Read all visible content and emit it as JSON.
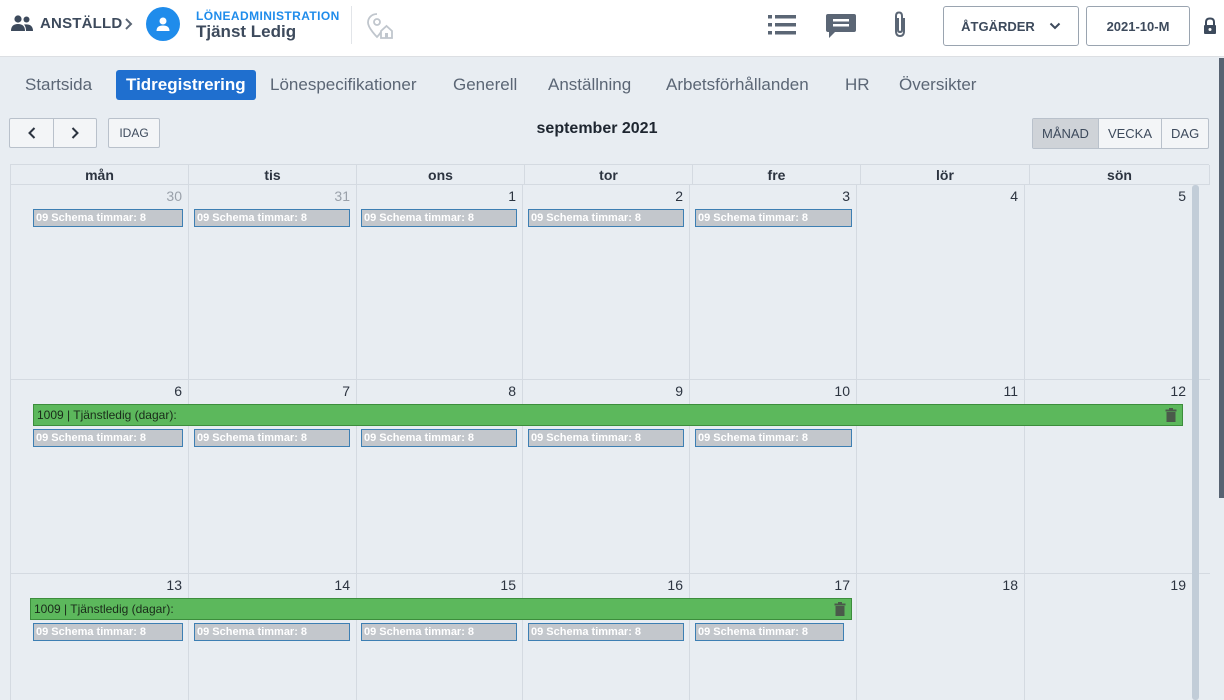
{
  "header": {
    "employee_label": "ANSTÄLLD",
    "module_label": "LÖNEADMINISTRATION",
    "person_name": "Tjänst Ledig",
    "actions_label": "ÅTGÄRDER",
    "period_label": "2021-10-M",
    "icons": [
      "people-icon",
      "chevron-right-icon",
      "person-icon",
      "location-home-icon",
      "list-icon",
      "chat-icon",
      "paperclip-icon",
      "chevron-down-icon",
      "lock-icon"
    ]
  },
  "tabs": [
    {
      "label": "Startsida",
      "active": false
    },
    {
      "label": "Tidregistrering",
      "active": true
    },
    {
      "label": "Lönespecifikationer",
      "active": false
    },
    {
      "label": "Generell",
      "active": false
    },
    {
      "label": "Anställning",
      "active": false
    },
    {
      "label": "Arbetsförhållanden",
      "active": false
    },
    {
      "label": "HR",
      "active": false
    },
    {
      "label": "Översikter",
      "active": false
    }
  ],
  "calendar": {
    "title": "september 2021",
    "today_label": "IDAG",
    "views": [
      {
        "label": "MÅNAD",
        "active": true
      },
      {
        "label": "VECKA",
        "active": false
      },
      {
        "label": "DAG",
        "active": false
      }
    ],
    "weekdays": [
      "mån",
      "tis",
      "ons",
      "tor",
      "fre",
      "lör",
      "sön"
    ],
    "weeks": [
      {
        "days": [
          "30",
          "31",
          "1",
          "2",
          "3",
          "4",
          "5"
        ],
        "other_month": [
          true,
          true,
          false,
          false,
          false,
          false,
          false
        ]
      },
      {
        "days": [
          "6",
          "7",
          "8",
          "9",
          "10",
          "11",
          "12"
        ],
        "other_month": [
          false,
          false,
          false,
          false,
          false,
          false,
          false
        ]
      },
      {
        "days": [
          "13",
          "14",
          "15",
          "16",
          "17",
          "18",
          "19"
        ],
        "other_month": [
          false,
          false,
          false,
          false,
          false,
          false,
          false
        ]
      }
    ],
    "schedule_event_label": "09 Schema timmar: 8",
    "leave_event_label": "1009 | Tjänstledig (dagar):",
    "colors": {
      "leave": "#5cb85c",
      "schedule": "#c3c7cc",
      "accent": "#1f6fcf"
    }
  }
}
